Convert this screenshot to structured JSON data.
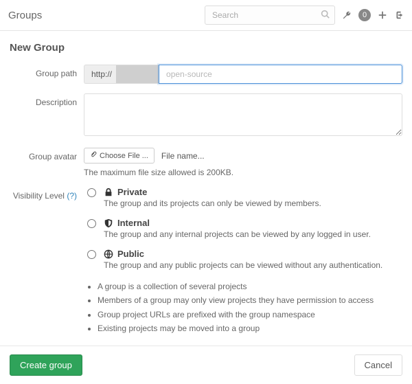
{
  "header": {
    "title": "Groups",
    "search_placeholder": "Search",
    "badge_count": "0"
  },
  "icons": {
    "search": "search-icon",
    "wrench": "wrench-icon",
    "plus": "plus-icon",
    "signout": "signout-icon",
    "attach": "attach-icon",
    "lock": "lock-icon",
    "shield": "shield-icon",
    "globe": "globe-icon"
  },
  "page": {
    "title": "New Group"
  },
  "form": {
    "path": {
      "label": "Group path",
      "scheme": "http://",
      "domain_redacted": true,
      "placeholder": "open-source",
      "value": ""
    },
    "description": {
      "label": "Description",
      "value": ""
    },
    "avatar": {
      "label": "Group avatar",
      "button": "Choose File ...",
      "filename": "File name...",
      "hint": "The maximum file size allowed is 200KB."
    },
    "visibility": {
      "label": "Visibility Level",
      "help": "(?)",
      "options": [
        {
          "title": "Private",
          "desc": "The group and its projects can only be viewed by members.",
          "selected": false
        },
        {
          "title": "Internal",
          "desc": "The group and any internal projects can be viewed by any logged in user.",
          "selected": false
        },
        {
          "title": "Public",
          "desc": "The group and any public projects can be viewed without any authentication.",
          "selected": false
        }
      ]
    },
    "notes": [
      "A group is a collection of several projects",
      "Members of a group may only view projects they have permission to access",
      "Group project URLs are prefixed with the group namespace",
      "Existing projects may be moved into a group"
    ]
  },
  "actions": {
    "submit": "Create group",
    "cancel": "Cancel"
  }
}
